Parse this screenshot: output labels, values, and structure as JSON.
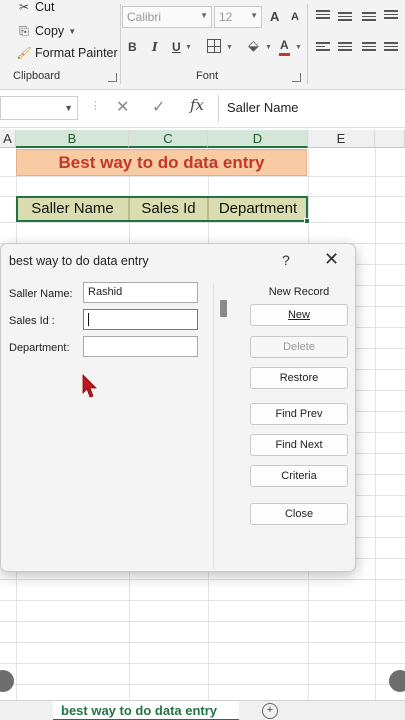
{
  "ribbon": {
    "clipboard": {
      "cut": "Cut",
      "copy": "Copy",
      "format_painter": "Format Painter",
      "group_label": "Clipboard"
    },
    "font": {
      "family": "Calibri",
      "size": "12",
      "bold": "B",
      "italic": "I",
      "underline": "U",
      "grow": "A",
      "shrink": "A",
      "color": "A",
      "group_label": "Font"
    }
  },
  "formula_bar": {
    "value": "Saller Name",
    "fx": "fx"
  },
  "columns": [
    "A",
    "B",
    "C",
    "D",
    "E"
  ],
  "sheet": {
    "title": "Best way to do data entry",
    "headers": [
      "Saller Name",
      "Sales Id",
      "Department"
    ]
  },
  "dialog": {
    "title": "best way to do data entry",
    "help": "?",
    "close": "✕",
    "fields": [
      {
        "label": "Saller Name:",
        "value": "Rashid"
      },
      {
        "label": "Sales Id :",
        "value": ""
      },
      {
        "label": "Department:",
        "value": ""
      }
    ],
    "record_label": "New Record",
    "buttons": {
      "new": "New",
      "delete": "Delete",
      "restore": "Restore",
      "find_prev": "Find Prev",
      "find_next": "Find Next",
      "criteria": "Criteria",
      "close": "Close"
    }
  },
  "sheet_tab": "best way to do data entry"
}
